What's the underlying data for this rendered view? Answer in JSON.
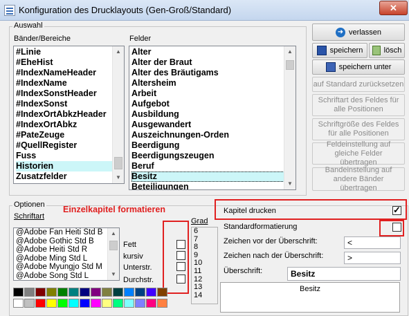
{
  "window": {
    "title": "Konfiguration des Drucklayouts (Gen-Groß/Standard)",
    "close_label": "✕"
  },
  "auswahl": {
    "group_label": "Auswahl",
    "baender_label": "Bänder/Bereiche",
    "felder_label": "Felder",
    "baender": [
      "#Linie",
      "#EheHist",
      "#IndexNameHeader",
      "#IndexName",
      "#IndexSonstHeader",
      "#IndexSonst",
      "#IndexOrtAbkzHeader",
      "#IndexOrtAbkz",
      "#PateZeuge",
      "#QuellRegister",
      "Fuss",
      "Historien",
      "Zusatzfelder"
    ],
    "baender_selected": "Historien",
    "felder": [
      "Alter",
      "Alter der Braut",
      "Alter des Bräutigams",
      "Altersheim",
      "Arbeit",
      "Aufgebot",
      "Ausbildung",
      "Ausgewandert",
      "Auszeichnungen-Orden",
      "Beerdigung",
      "Beerdigungszeugen",
      "Beruf",
      "Besitz",
      "Beteiligungen"
    ],
    "felder_selected": "Besitz"
  },
  "buttons": {
    "verlassen": "verlassen",
    "speichern": "speichern",
    "loesch": "lösch",
    "speichern_unter": "speichern unter",
    "standard_reset": "auf Standard zurücksetzen",
    "schriftart_feld": "Schriftart des Feldes für alle Positionen",
    "schriftgroesse_feld": "Schriftgröße des Feldes für alle Positionen",
    "feldeinstellung": "Feldeinstellung auf gleiche Felder übertragen",
    "bandeinstellung": "Bandeinstellung auf andere Bänder übertragen"
  },
  "optionen": {
    "group_label": "Optionen",
    "schriftart_label": "Schriftart",
    "annotation": "Einzelkapitel formatieren",
    "fonts": [
      "@Adobe Fan Heiti Std B",
      "@Adobe Gothic Std B",
      "@Adobe Heiti Std R",
      "@Adobe Ming Std L",
      "@Adobe Myungjo Std M",
      "@Adobe Song Std L"
    ],
    "styles": [
      {
        "label": "Fett",
        "checked": false
      },
      {
        "label": "kursiv",
        "checked": false
      },
      {
        "label": "Unterstr.",
        "checked": false
      },
      {
        "label": "Durchstr.",
        "checked": false
      }
    ],
    "grad_label": "Grad",
    "grad": [
      "6",
      "7",
      "8",
      "9",
      "10",
      "11",
      "12",
      "13",
      "14"
    ],
    "kapitel_drucken": {
      "label": "Kapitel drucken",
      "checked": true
    },
    "standardformatierung": {
      "label": "Standardformatierung",
      "checked": false
    },
    "zeichen_vor_label": "Zeichen vor der Überschrift:",
    "zeichen_vor_value": "<",
    "zeichen_nach_label": "Zeichen nach der Überschrift:",
    "zeichen_nach_value": ">",
    "ueberschrift_label": "Überschrift:",
    "ueberschrift_value": "Besitz",
    "preview_text": "Besitz"
  },
  "palette": {
    "row1": [
      "#000000",
      "#808080",
      "#800000",
      "#808000",
      "#008000",
      "#008080",
      "#000080",
      "#800080",
      "#808040",
      "#004040",
      "#0080ff",
      "#004080",
      "#4000ff",
      "#804000"
    ],
    "row2": [
      "#ffffff",
      "#c0c0c0",
      "#ff0000",
      "#ffff00",
      "#00ff00",
      "#00ffff",
      "#0000ff",
      "#ff00ff",
      "#ffff80",
      "#00ff80",
      "#80ffff",
      "#8080ff",
      "#ff0080",
      "#ff8040"
    ]
  }
}
